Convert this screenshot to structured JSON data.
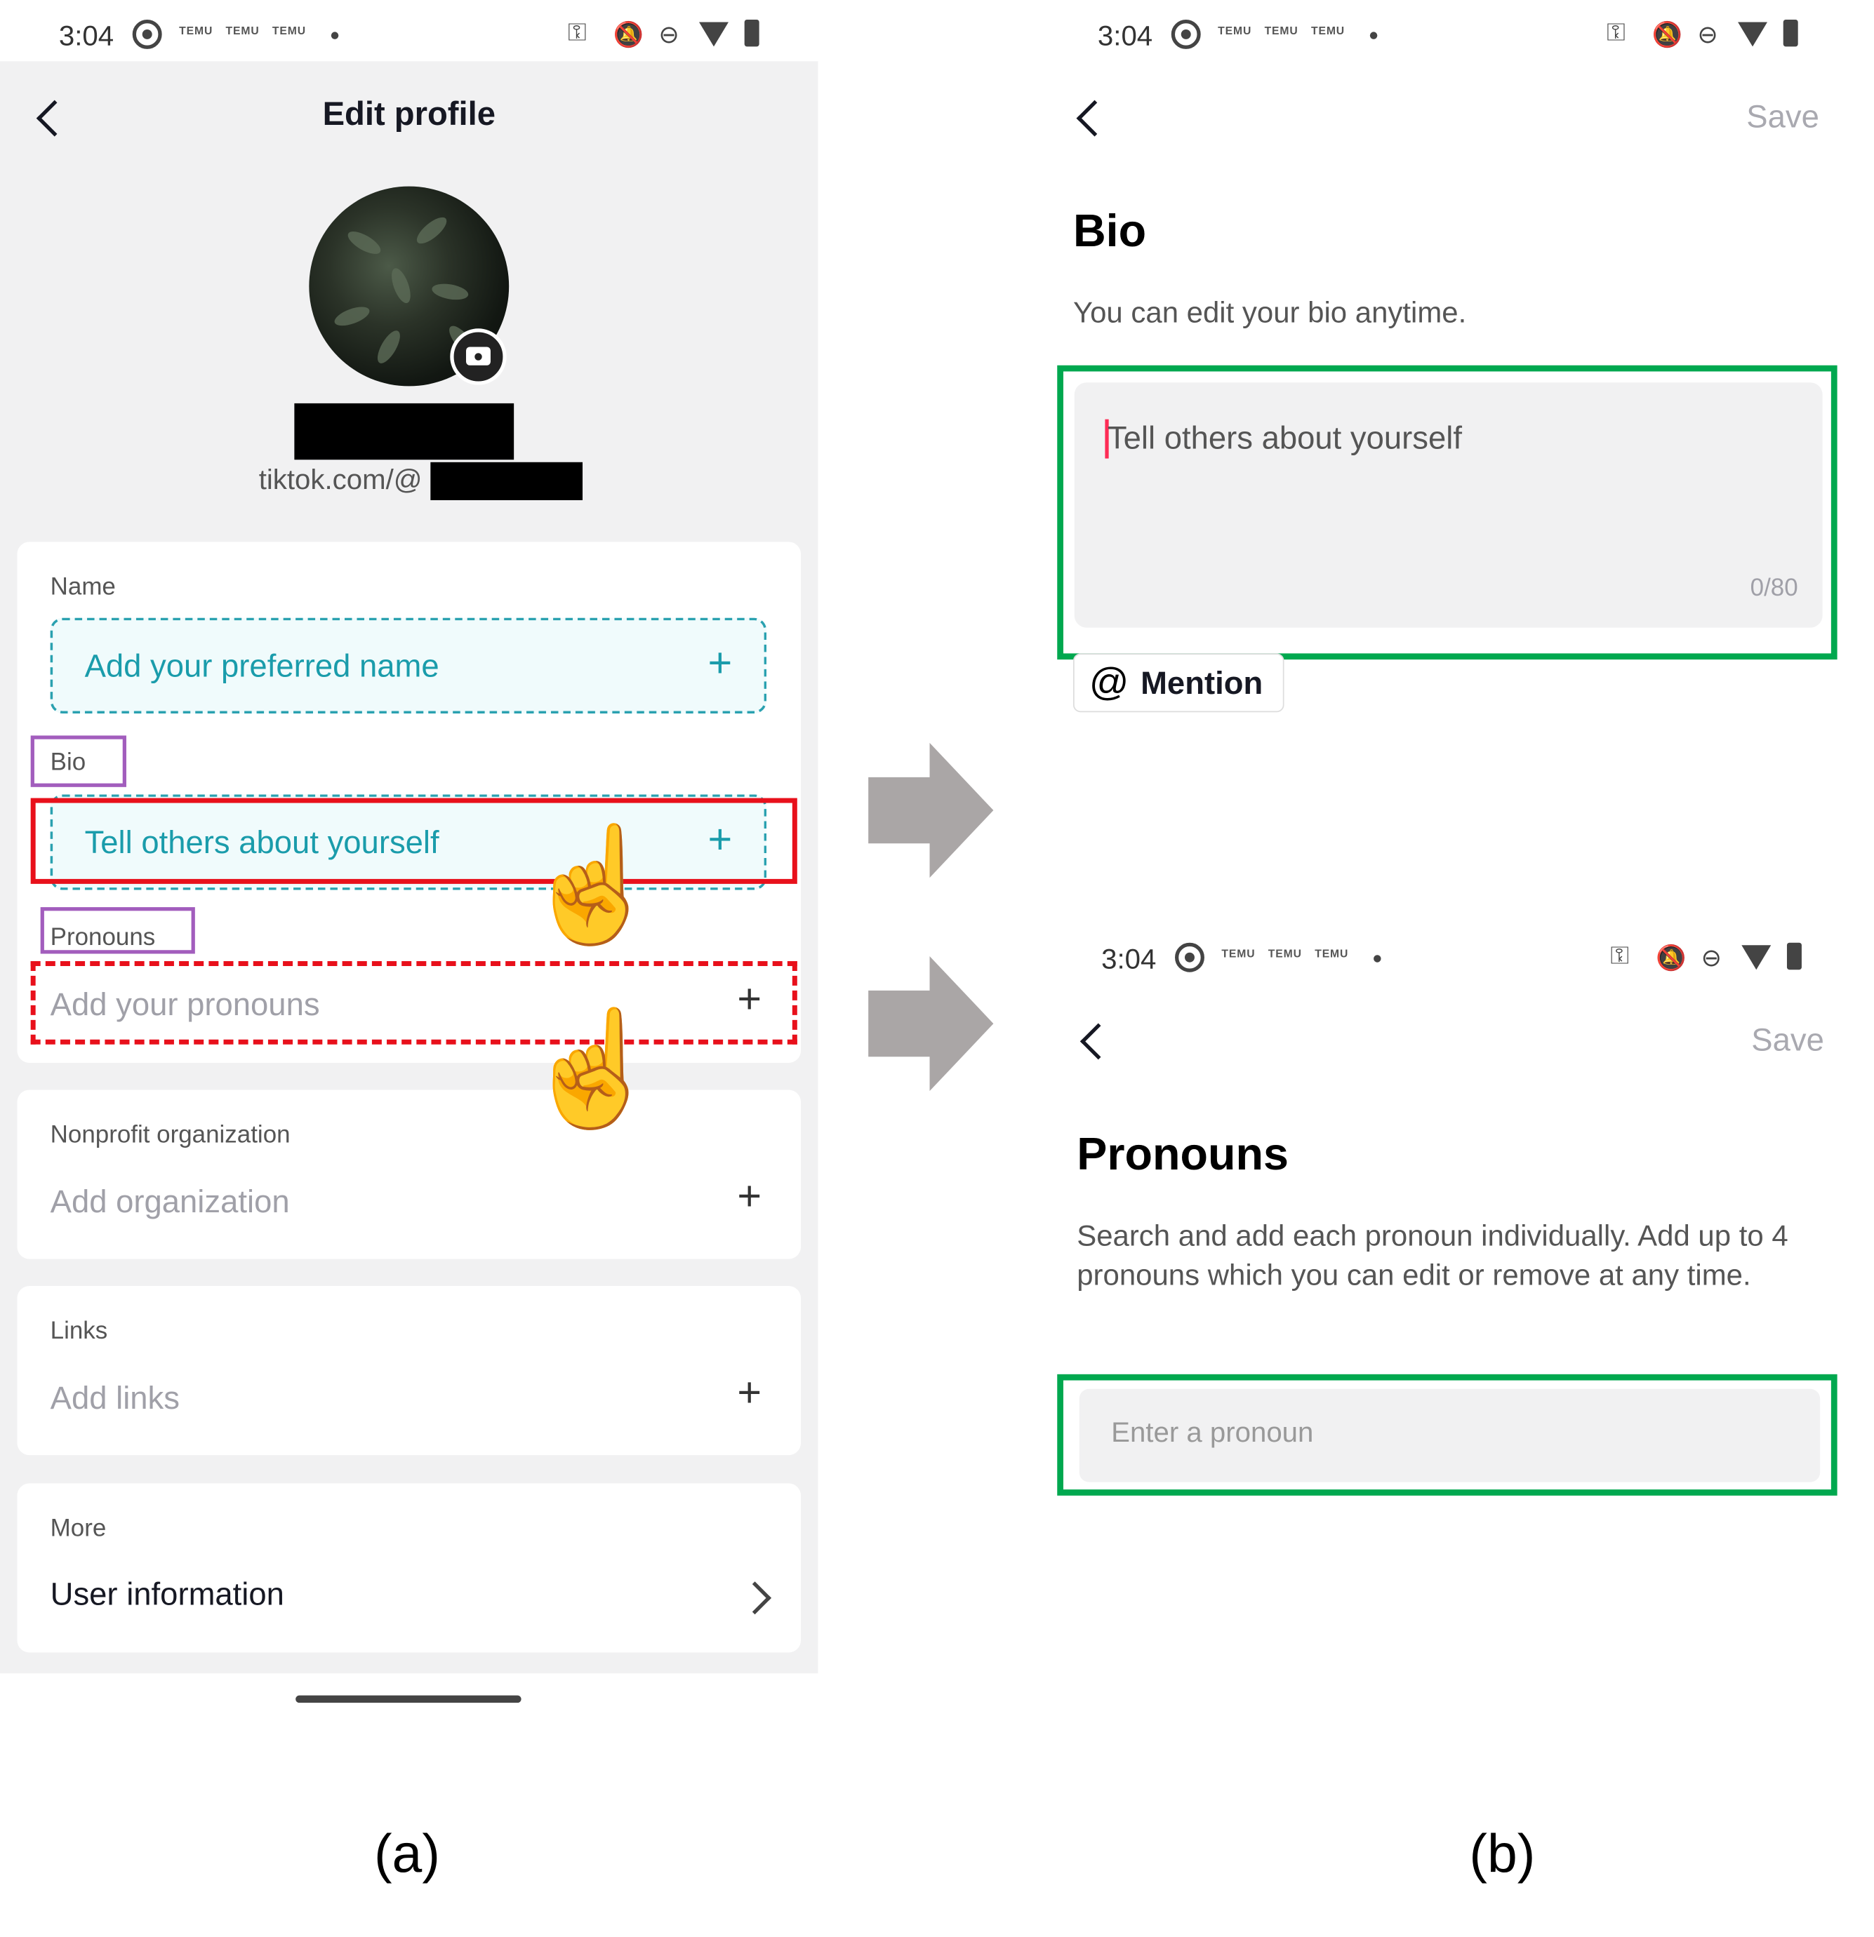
{
  "status_bar": {
    "time": "3:04",
    "temu_label": "TEMU"
  },
  "left_screen": {
    "title": "Edit profile",
    "handle_prefix": "tiktok.com/@",
    "name_section": {
      "label": "Name",
      "placeholder": "Add your preferred name"
    },
    "bio_section": {
      "label": "Bio",
      "placeholder": "Tell others about yourself"
    },
    "pronouns_section": {
      "label": "Pronouns",
      "placeholder": "Add your pronouns"
    },
    "nonprofit_section": {
      "label": "Nonprofit organization",
      "placeholder": "Add organization"
    },
    "links_section": {
      "label": "Links",
      "placeholder": "Add links"
    },
    "more_section": {
      "label": "More",
      "item": "User information"
    }
  },
  "bio_screen": {
    "save_label": "Save",
    "title": "Bio",
    "description": "You can edit your bio anytime.",
    "placeholder": "Tell others about yourself",
    "char_count": "0/80",
    "mention_symbol": "@",
    "mention_label": "Mention"
  },
  "pronouns_screen": {
    "save_label": "Save",
    "title": "Pronouns",
    "description": "Search and add each pronoun individually. Add up to 4 pronouns which you can edit or remove at any time.",
    "placeholder": "Enter a pronoun"
  },
  "captions": {
    "left": "(a)",
    "right": "(b)"
  },
  "colors": {
    "accent_teal": "#1a9cab",
    "highlight_red": "#e8101b",
    "highlight_purple": "#a25dbd",
    "highlight_green": "#00a84f",
    "arrow_gray": "#aaa6a6"
  }
}
